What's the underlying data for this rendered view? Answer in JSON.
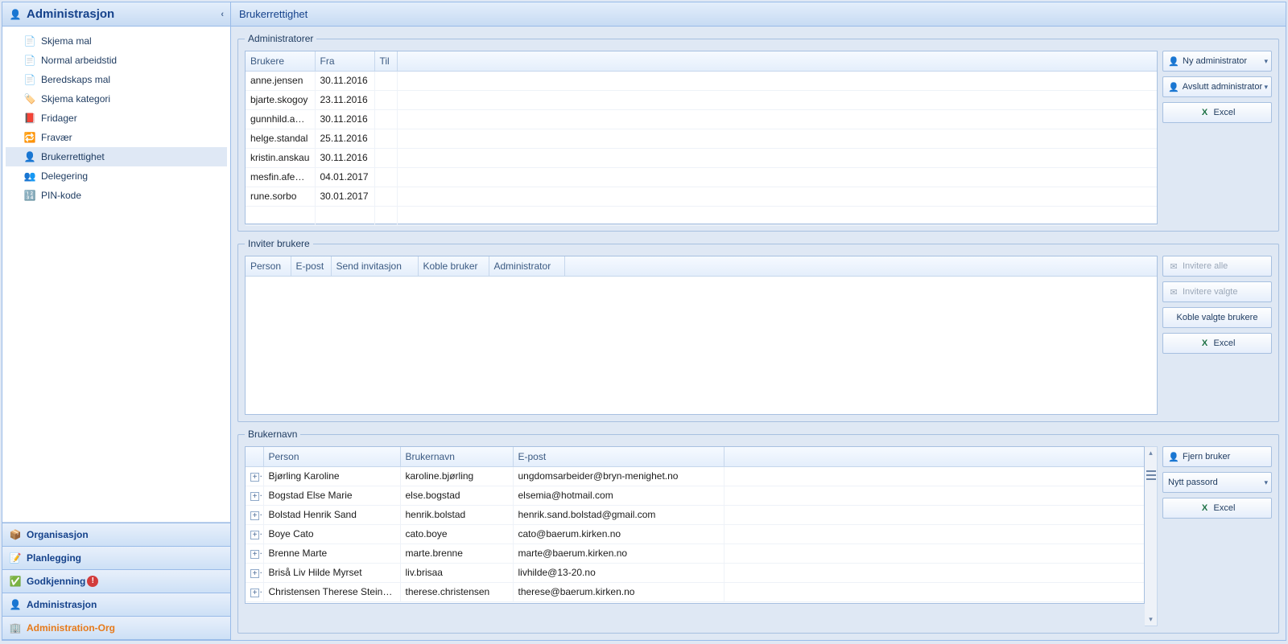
{
  "sidebar": {
    "title": "Administrasjon",
    "tree": [
      {
        "icon": "📄",
        "label": "Skjema mal"
      },
      {
        "icon": "📄",
        "label": "Normal arbeidstid"
      },
      {
        "icon": "📄",
        "label": "Beredskaps mal"
      },
      {
        "icon": "🏷️",
        "label": "Skjema kategori"
      },
      {
        "icon": "📕",
        "label": "Fridager"
      },
      {
        "icon": "🔁",
        "label": "Fravær"
      },
      {
        "icon": "👤",
        "label": "Brukerrettighet",
        "selected": true
      },
      {
        "icon": "👥",
        "label": "Delegering"
      },
      {
        "icon": "🔢",
        "label": "PIN-kode"
      }
    ],
    "accordion": [
      {
        "icon": "📦",
        "label": "Organisasjon"
      },
      {
        "icon": "📝",
        "label": "Planlegging"
      },
      {
        "icon": "✅",
        "label": "Godkjenning",
        "badge": true
      },
      {
        "icon": "👤",
        "label": "Administrasjon"
      },
      {
        "icon": "🏢",
        "label": "Administration-Org",
        "active": true
      }
    ]
  },
  "main": {
    "title": "Brukerrettighet",
    "admins": {
      "legend": "Administratorer",
      "headers": {
        "brukere": "Brukere",
        "fra": "Fra",
        "til": "Til"
      },
      "rows": [
        {
          "user": "anne.jensen",
          "from": "30.11.2016",
          "to": ""
        },
        {
          "user": "bjarte.skogoy",
          "from": "23.11.2016",
          "to": ""
        },
        {
          "user": "gunnhild.anda",
          "from": "30.11.2016",
          "to": ""
        },
        {
          "user": "helge.standal",
          "from": "25.11.2016",
          "to": ""
        },
        {
          "user": "kristin.anskau",
          "from": "30.11.2016",
          "to": ""
        },
        {
          "user": "mesfin.afewerk",
          "from": "04.01.2017",
          "to": ""
        },
        {
          "user": "rune.sorbo",
          "from": "30.01.2017",
          "to": ""
        }
      ],
      "actions": {
        "new": "Ny administrator",
        "end": "Avslutt administrator",
        "excel": "Excel"
      }
    },
    "invite": {
      "legend": "Inviter brukere",
      "headers": {
        "person": "Person",
        "epost": "E-post",
        "send": "Send invitasjon",
        "koble": "Koble bruker",
        "admin": "Administrator"
      },
      "actions": {
        "invite_all": "Invitere alle",
        "invite_selected": "Invitere valgte",
        "link_selected": "Koble valgte brukere",
        "excel": "Excel"
      }
    },
    "usernames": {
      "legend": "Brukernavn",
      "headers": {
        "person": "Person",
        "brukernavn": "Brukernavn",
        "epost": "E-post"
      },
      "rows": [
        {
          "person": "Bjørling Karoline",
          "user": "karoline.bjørling",
          "email": "ungdomsarbeider@bryn-menighet.no"
        },
        {
          "person": "Bogstad Else Marie",
          "user": "else.bogstad",
          "email": "elsemia@hotmail.com"
        },
        {
          "person": "Bolstad Henrik Sand",
          "user": "henrik.bolstad",
          "email": "henrik.sand.bolstad@gmail.com"
        },
        {
          "person": "Boye Cato",
          "user": "cato.boye",
          "email": "cato@baerum.kirken.no"
        },
        {
          "person": "Brenne Marte",
          "user": "marte.brenne",
          "email": "marte@baerum.kirken.no"
        },
        {
          "person": "Briså Liv Hilde Myrset",
          "user": "liv.brisaa",
          "email": "livhilde@13-20.no"
        },
        {
          "person": "Christensen Therese Steinnes",
          "user": "therese.christensen",
          "email": "therese@baerum.kirken.no"
        }
      ],
      "actions": {
        "remove": "Fjern bruker",
        "new_pwd": "Nytt passord",
        "excel": "Excel"
      }
    }
  }
}
